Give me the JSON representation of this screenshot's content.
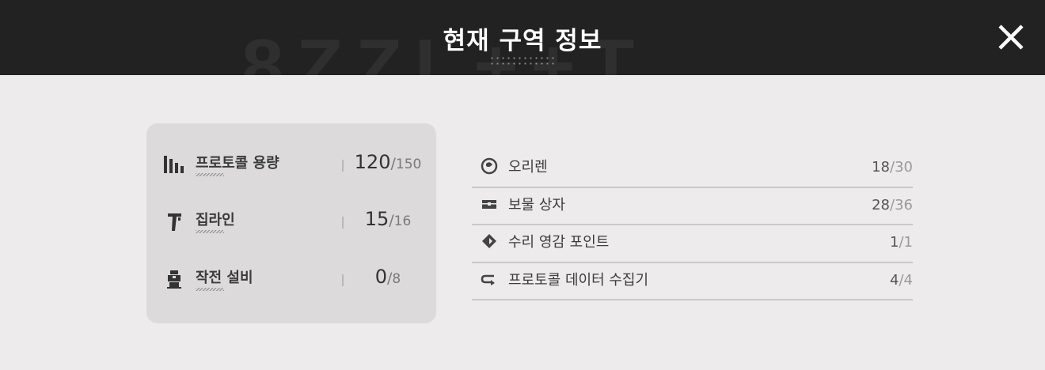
{
  "header": {
    "title": "현재 구역 정보",
    "watermark": "8ZZL++T",
    "close_icon": "close-x-icon"
  },
  "left_stats": [
    {
      "icon": "bars-icon",
      "label": "프로토콜 용량",
      "current": "120",
      "max": "150"
    },
    {
      "icon": "zipline-icon",
      "label": "집라인",
      "current": "15",
      "max": "16"
    },
    {
      "icon": "equipment-icon",
      "label": "작전 설비",
      "current": "0",
      "max": "8"
    }
  ],
  "right_list": [
    {
      "icon": "orirene-icon",
      "label": "오리렌",
      "current": "18",
      "max": "30"
    },
    {
      "icon": "chest-icon",
      "label": "보물 상자",
      "current": "28",
      "max": "36"
    },
    {
      "icon": "inspiration-icon",
      "label": "수리 영감 포인트",
      "current": "1",
      "max": "1"
    },
    {
      "icon": "collector-icon",
      "label": "프로토콜 데이터 수집기",
      "current": "4",
      "max": "4"
    }
  ],
  "separator": "/",
  "colors": {
    "header_bg": "#222222",
    "page_bg": "#edebec",
    "card_bg": "#dcdadb"
  }
}
